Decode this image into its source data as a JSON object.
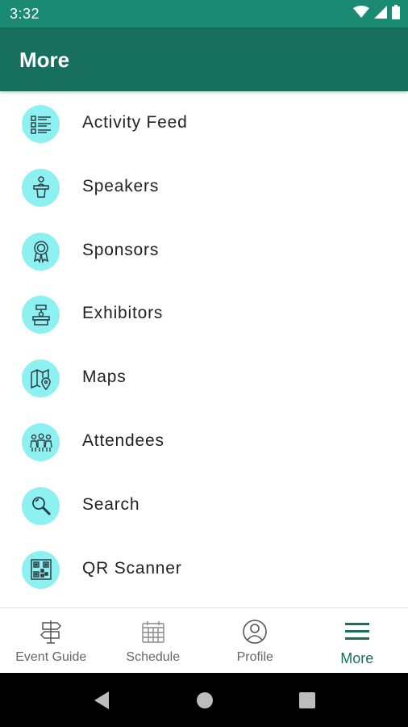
{
  "status_bar": {
    "time": "3:32",
    "icons": [
      "wifi-icon",
      "cell-signal-icon",
      "battery-icon"
    ]
  },
  "app_bar": {
    "title": "More",
    "color": "#16705d"
  },
  "menu": {
    "icon_background": "#8ef1f1",
    "items": [
      {
        "label": "Activity Feed",
        "icon": "activity-feed-icon"
      },
      {
        "label": "Speakers",
        "icon": "speaker-podium-icon"
      },
      {
        "label": "Sponsors",
        "icon": "award-ribbon-icon"
      },
      {
        "label": "Exhibitors",
        "icon": "exhibitor-booth-icon"
      },
      {
        "label": "Maps",
        "icon": "map-pin-icon"
      },
      {
        "label": "Attendees",
        "icon": "people-group-icon"
      },
      {
        "label": "Search",
        "icon": "search-icon"
      },
      {
        "label": "QR Scanner",
        "icon": "qr-code-icon"
      }
    ]
  },
  "bottom_nav": {
    "active_color": "#16705d",
    "tabs": [
      {
        "label": "Event Guide",
        "icon": "signpost-icon",
        "active": false
      },
      {
        "label": "Schedule",
        "icon": "calendar-icon",
        "active": false
      },
      {
        "label": "Profile",
        "icon": "profile-icon",
        "active": false
      },
      {
        "label": "More",
        "icon": "hamburger-menu-icon",
        "active": true
      }
    ]
  },
  "system_nav": {
    "buttons": [
      "back-icon",
      "home-icon",
      "recents-icon"
    ]
  }
}
